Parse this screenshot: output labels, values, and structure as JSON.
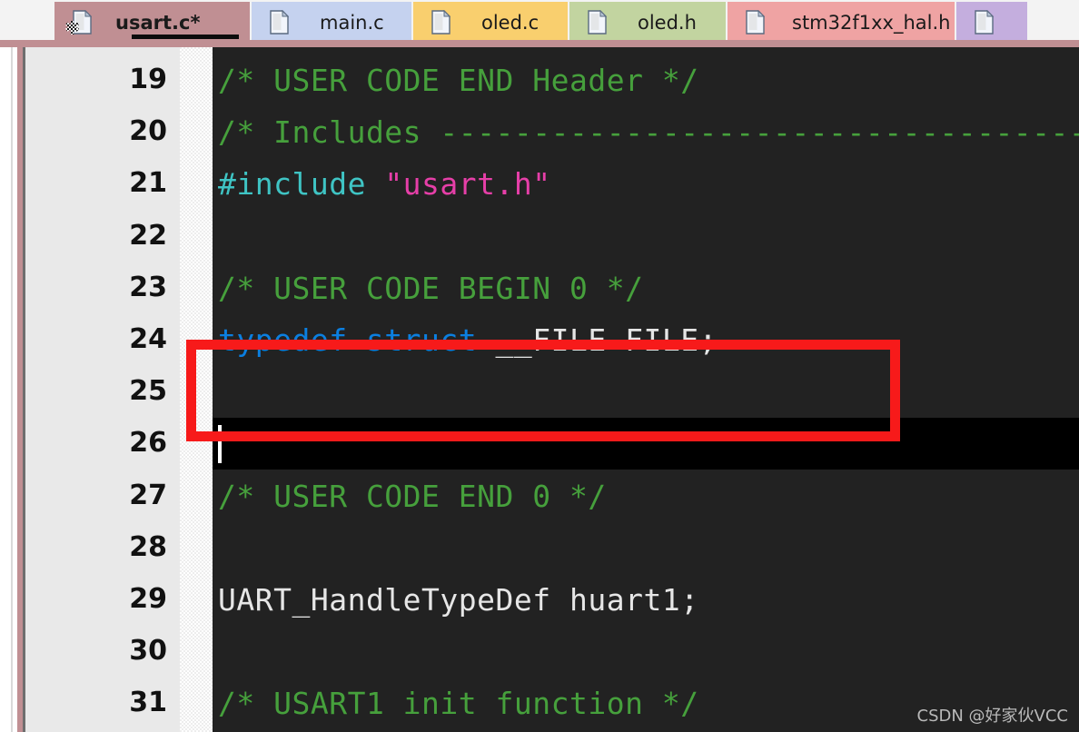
{
  "window": {
    "kind": "code-editor",
    "accent_active_tab": "#c08f93",
    "editor_background": "#222222",
    "gutter_background": "#e9e9e9",
    "highlight_box_color": "#f71a1a"
  },
  "tabs": [
    {
      "label": "usart.c*",
      "color": "#c08f93",
      "active": true,
      "modified": true,
      "icon": "file-icon"
    },
    {
      "label": "main.c",
      "color": "#c5d2ef",
      "active": false,
      "modified": false,
      "icon": "file-icon"
    },
    {
      "label": "oled.c",
      "color": "#f9cf6e",
      "active": false,
      "modified": false,
      "icon": "file-icon"
    },
    {
      "label": "oled.h",
      "color": "#c2d4a0",
      "active": false,
      "modified": false,
      "icon": "file-icon"
    },
    {
      "label": "stm32f1xx_hal.h",
      "color": "#efa3a3",
      "active": false,
      "modified": false,
      "icon": "file-icon"
    },
    {
      "label": "",
      "color": "#c4aede",
      "active": false,
      "modified": false,
      "icon": "file-icon"
    }
  ],
  "editor": {
    "first_line_number": 19,
    "cursor_line_number": 26,
    "lines": [
      {
        "number": 19,
        "tokens": [
          {
            "text": "/* USER CODE END Header */",
            "style": "c-comment"
          }
        ]
      },
      {
        "number": 20,
        "tokens": [
          {
            "text": "/* Includes ---------------------------------------------------",
            "style": "c-comment"
          }
        ]
      },
      {
        "number": 21,
        "tokens": [
          {
            "text": "#include ",
            "style": "c-pre"
          },
          {
            "text": "\"usart.h\"",
            "style": "c-string"
          }
        ]
      },
      {
        "number": 22,
        "tokens": []
      },
      {
        "number": 23,
        "tokens": [
          {
            "text": "/* USER CODE BEGIN 0 */",
            "style": "c-comment"
          }
        ]
      },
      {
        "number": 24,
        "tokens": [
          {
            "text": "typedef struct ",
            "style": "c-kw"
          },
          {
            "text": "__FILE FILE;",
            "style": "c-plain"
          }
        ]
      },
      {
        "number": 25,
        "tokens": []
      },
      {
        "number": 26,
        "tokens": []
      },
      {
        "number": 27,
        "tokens": [
          {
            "text": "/* USER CODE END 0 */",
            "style": "c-comment"
          }
        ]
      },
      {
        "number": 28,
        "tokens": []
      },
      {
        "number": 29,
        "tokens": [
          {
            "text": "UART_HandleTypeDef huart1;",
            "style": "c-plain"
          }
        ]
      },
      {
        "number": 30,
        "tokens": []
      },
      {
        "number": 31,
        "tokens": [
          {
            "text": "/* USART1 init function */",
            "style": "c-comment"
          }
        ]
      }
    ],
    "highlight": {
      "label": "red-annotation-box",
      "covers_line": 24
    }
  },
  "watermark": {
    "text": "CSDN @好家伙VCC"
  }
}
